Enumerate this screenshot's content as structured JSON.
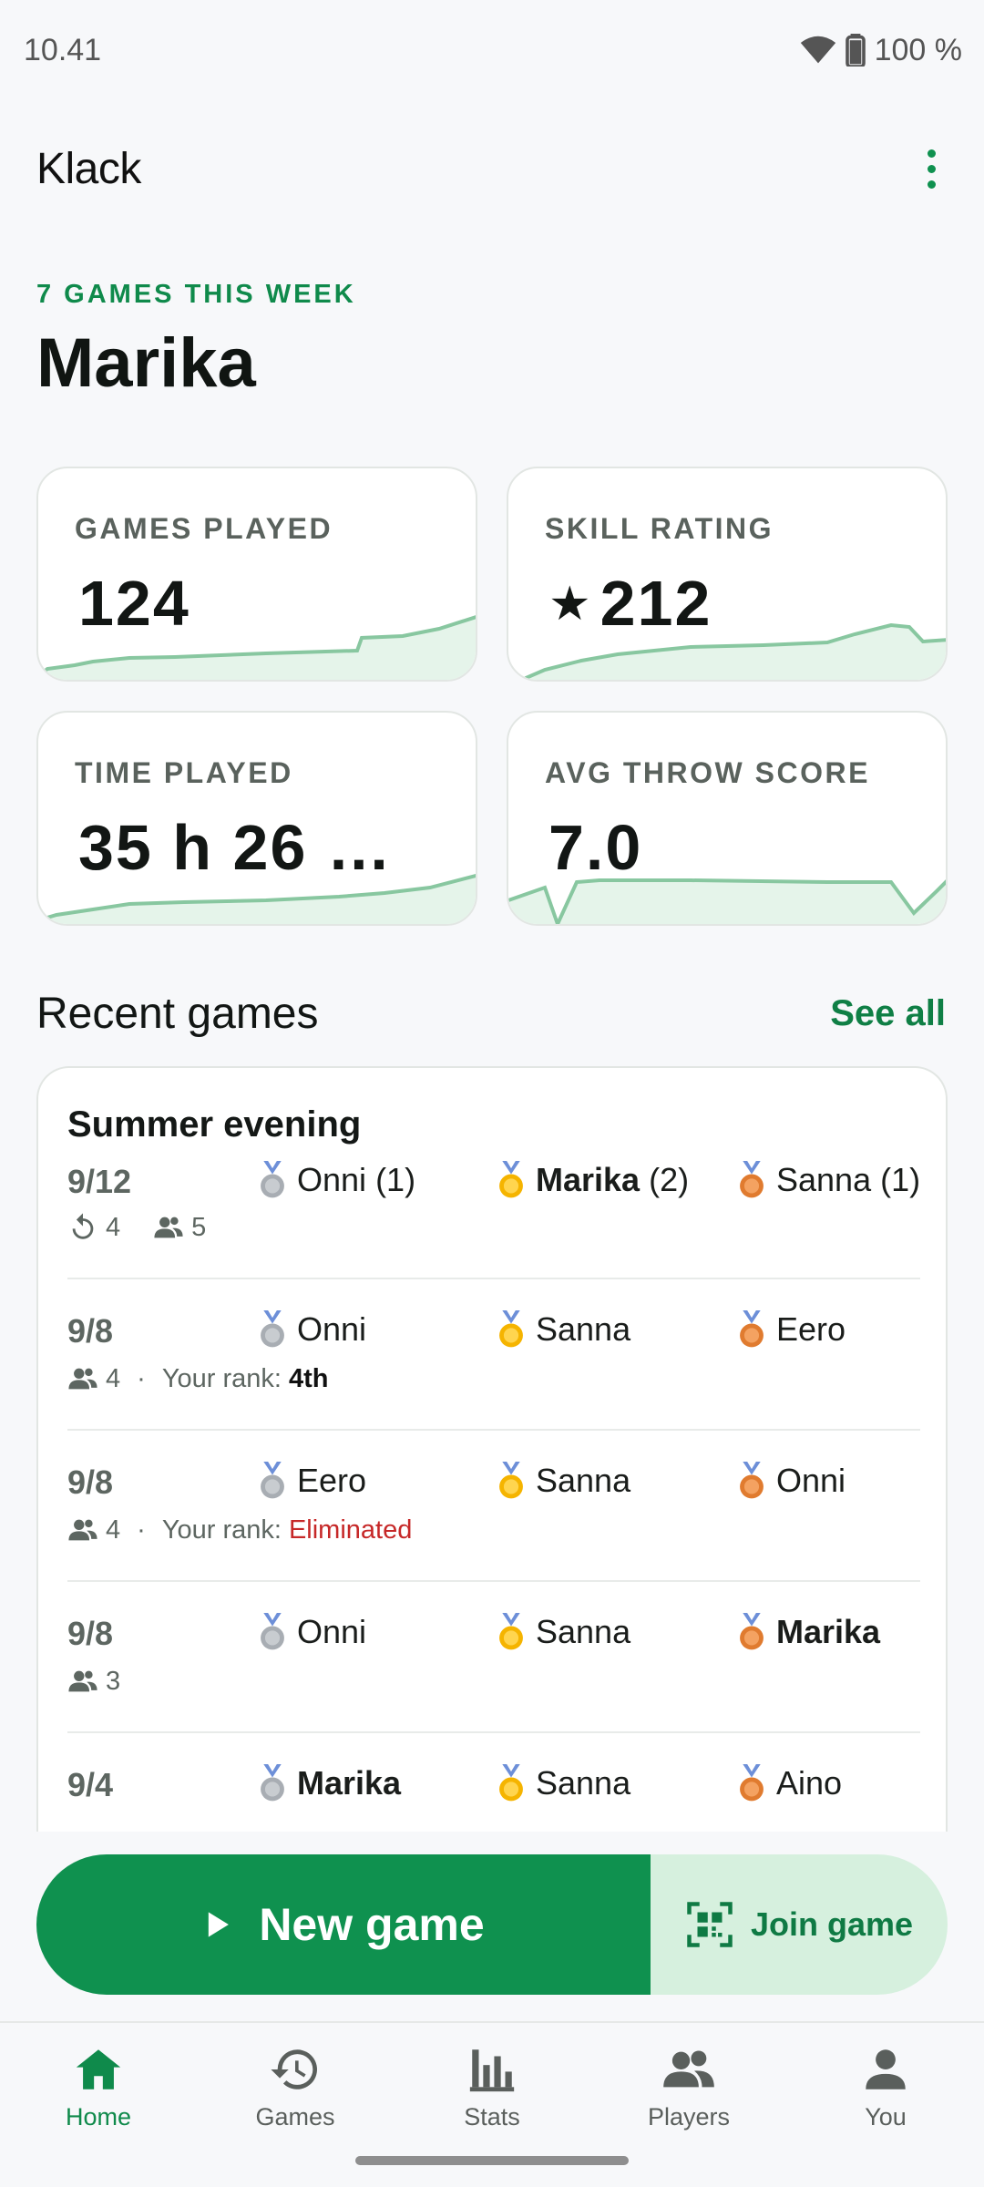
{
  "status_bar": {
    "time": "10.41",
    "battery": "100 %"
  },
  "app": {
    "title": "Klack"
  },
  "header": {
    "week_label": "7 GAMES THIS WEEK",
    "player_name": "Marika"
  },
  "stats": [
    {
      "label": "GAMES PLAYED",
      "value": "124"
    },
    {
      "label": "SKILL RATING",
      "value": "212"
    },
    {
      "label": "TIME PLAYED",
      "value": "35 h 26 …"
    },
    {
      "label": "AVG THROW SCORE",
      "value": "7.0"
    }
  ],
  "recent": {
    "title": "Recent games",
    "see_all": "See all",
    "games": [
      {
        "name": "Summer evening",
        "date": "9/12",
        "players": [
          {
            "name": "Onni",
            "score": "(1)",
            "bold": false
          },
          {
            "name": "Marika",
            "score": "(2)",
            "bold": true
          },
          {
            "name": "Sanna",
            "score": "(1)",
            "bold": false
          }
        ],
        "rounds": "4",
        "player_count": "5"
      },
      {
        "date": "9/8",
        "players": [
          {
            "name": "Onni"
          },
          {
            "name": "Sanna"
          },
          {
            "name": "Eero"
          }
        ],
        "player_count": "4",
        "rank_label": "Your rank:",
        "rank_value": "4th"
      },
      {
        "date": "9/8",
        "players": [
          {
            "name": "Eero"
          },
          {
            "name": "Sanna"
          },
          {
            "name": "Onni"
          }
        ],
        "player_count": "4",
        "rank_label": "Your rank:",
        "rank_value": "Eliminated"
      },
      {
        "date": "9/8",
        "players": [
          {
            "name": "Onni"
          },
          {
            "name": "Sanna"
          },
          {
            "name": "Marika"
          }
        ],
        "player_count": "3"
      },
      {
        "date": "9/4",
        "players": [
          {
            "name": "Marika"
          },
          {
            "name": "Sanna"
          },
          {
            "name": "Aino"
          }
        ]
      }
    ]
  },
  "actions": {
    "new_game": "New game",
    "join_game": "Join game"
  },
  "nav": {
    "home": "Home",
    "games": "Games",
    "stats": "Stats",
    "players": "Players",
    "you": "You"
  },
  "colors": {
    "accent": "#0f914f",
    "accent_light": "#d6f0de",
    "gold": "#f5b400",
    "silver": "#a8adb3",
    "bronze": "#e07b2f",
    "eliminated": "#c62828"
  }
}
